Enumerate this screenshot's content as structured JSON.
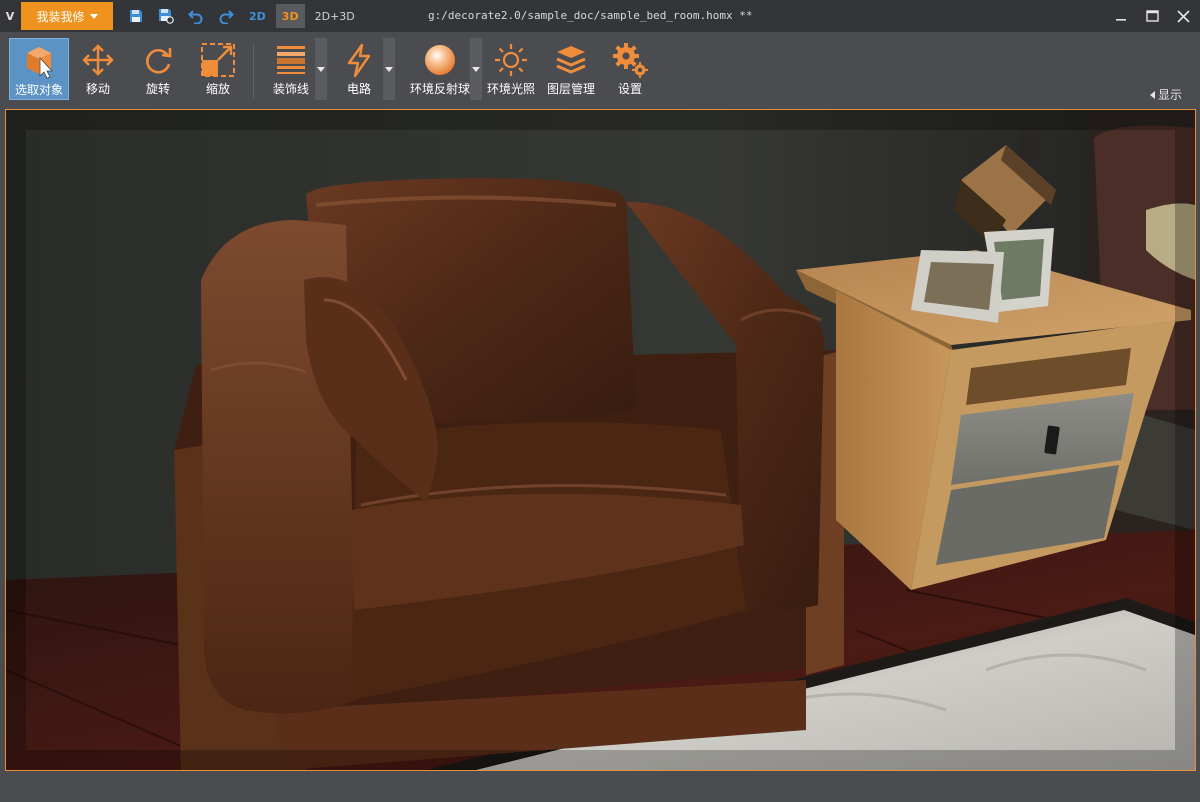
{
  "app": {
    "logo_letter": "V",
    "menu_label": "我装我修",
    "file_path": "g:/decorate2.0/sample_doc/sample_bed_room.homx **"
  },
  "quick_access": {
    "view_2d": "2D",
    "view_3d": "3D",
    "view_2d3d": "2D+3D",
    "active_view": "3D"
  },
  "toolbar": {
    "select_label": "选取对象",
    "move_label": "移动",
    "rotate_label": "旋转",
    "scale_label": "缩放",
    "molding_label": "装饰线",
    "circuit_label": "电路",
    "env_sphere_label": "环境反射球",
    "env_light_label": "环境光照",
    "layer_label": "图层管理",
    "settings_label": "设置",
    "show_label": "显示"
  },
  "colors": {
    "accent_orange": "#f0921e",
    "selected_blue": "#5d93c4",
    "titlebar": "#333538",
    "toolbar": "#4b4c50",
    "viewport_border": "#e58e3c"
  },
  "icons": {
    "save": "save-icon",
    "save_as": "save-as-icon",
    "undo": "undo-icon",
    "redo": "redo-icon",
    "minimize": "minimize-icon",
    "maximize": "maximize-icon",
    "close": "close-icon"
  }
}
